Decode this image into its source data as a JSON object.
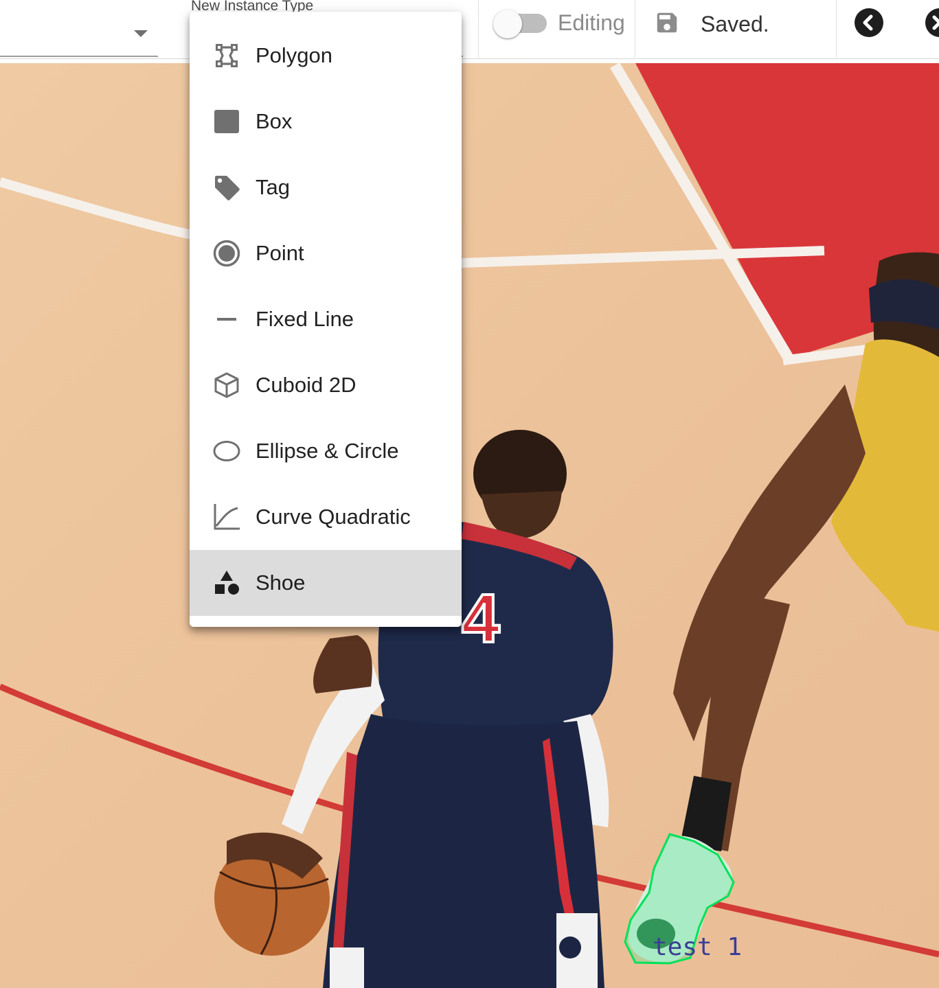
{
  "toolbar": {
    "instance_type_label": "New Instance Type",
    "edit_toggle_label": "Editing",
    "edit_toggle_on": false,
    "save_status": "Saved."
  },
  "menu": {
    "selected": "Shoe",
    "items": [
      {
        "label": "Polygon",
        "icon": "polygon-icon"
      },
      {
        "label": "Box",
        "icon": "box-icon"
      },
      {
        "label": "Tag",
        "icon": "tag-icon"
      },
      {
        "label": "Point",
        "icon": "point-icon"
      },
      {
        "label": "Fixed Line",
        "icon": "fixed-line-icon"
      },
      {
        "label": "Cuboid 2D",
        "icon": "cuboid-icon"
      },
      {
        "label": "Ellipse & Circle",
        "icon": "ellipse-icon"
      },
      {
        "label": "Curve Quadratic",
        "icon": "curve-icon"
      },
      {
        "label": "Shoe",
        "icon": "shapes-icon"
      }
    ]
  },
  "annotation": {
    "label": "test 1",
    "color": "#00e15a"
  },
  "colors": {
    "menu_selected_bg": "#dcdcdc",
    "icon_grey": "#707070",
    "toggle_track": "#bdbdbd"
  }
}
